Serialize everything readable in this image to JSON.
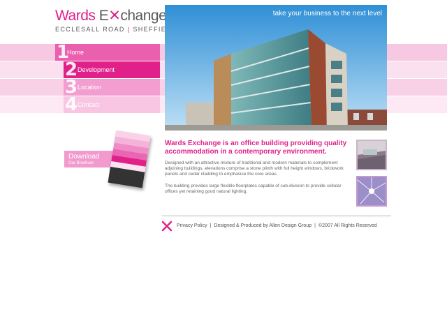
{
  "logo": {
    "word1": "Wards",
    "word2_pre": "E",
    "word2_post": "change",
    "sub_left": "ECCLESALL ROAD",
    "sub_right": "SHEFFIELD"
  },
  "nav": [
    {
      "num": "1",
      "label": "Home"
    },
    {
      "num": "2",
      "label": "Development"
    },
    {
      "num": "3",
      "label": "Location"
    },
    {
      "num": "4",
      "label": "Contact"
    }
  ],
  "download": {
    "line1": "Download",
    "line2": "Our Brochure"
  },
  "hero": {
    "tagline": "take your business to the next level"
  },
  "content": {
    "headline": "Wards Exchange is an office building providing quality accommodation in a contemporary environment.",
    "p1": "Designed with an attractive mixture of traditional and modern materials to complement adjoining buildings, elevations comprise a stone plinth with full height windows, brickwork panels and cedar cladding to emphasise the core areas.",
    "p2": "The building provides large flexible floorplates capable of sub-division to provide cellular offices yet retaining good natural lighting."
  },
  "footer": {
    "privacy": "Privacy Policy",
    "designed": "Designed & Produced by Allen Design Group",
    "copyright": "©2007 All Rights Reserved"
  },
  "colors": {
    "accent": "#e0218a",
    "nav_light": "#f8c5e3",
    "nav_mid": "#f39ed0",
    "text": "#666666"
  }
}
